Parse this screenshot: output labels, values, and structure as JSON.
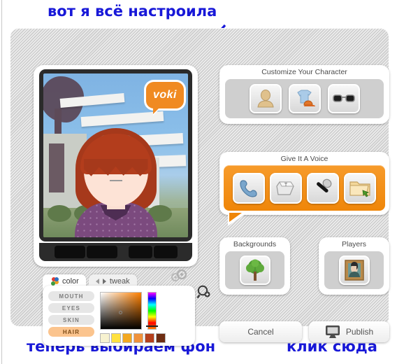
{
  "app": {
    "name": "voki-character-creator",
    "logo_text": "voki",
    "accent_color": "#f08a22",
    "panel_bg": "#dedede"
  },
  "preview": {
    "name": "avatar-preview",
    "dice_button_label": "",
    "zoom_button_label": "",
    "character": {
      "hair_color": "#a6391b",
      "skin_color": "#fde3d6",
      "outfit_color": "#7b4a7e",
      "has_glasses": true
    }
  },
  "color_panel": {
    "tabs": [
      {
        "label": "color",
        "active": true,
        "icon": "color-dots-icon"
      },
      {
        "label": "tweak",
        "active": false,
        "icon": "prev-next-arrows-icon"
      }
    ],
    "parts": [
      {
        "label": "MOUTH",
        "active": false
      },
      {
        "label": "EYES",
        "active": false
      },
      {
        "label": "SKIN",
        "active": false
      },
      {
        "label": "HAIR",
        "active": true
      }
    ],
    "swatches": [
      "#f7f2d0",
      "#ffe13f",
      "#f3a820",
      "#f0923b",
      "#b5401c",
      "#6e2d12"
    ],
    "selected_part": "HAIR",
    "picker_hue": "#ff8000"
  },
  "cards": {
    "customize": {
      "title": "Customize Your Character",
      "buttons": [
        {
          "icon": "head-silhouette-icon",
          "label": ""
        },
        {
          "icon": "clothing-shirt-cap-icon",
          "label": ""
        },
        {
          "icon": "sunglasses-icon",
          "label": ""
        }
      ]
    },
    "voice": {
      "title": "Give It A Voice",
      "highlight_color": "#ef8609",
      "buttons": [
        {
          "icon": "telephone-icon",
          "label": ""
        },
        {
          "icon": "keyboard-key-icon",
          "label": ""
        },
        {
          "icon": "microphone-icon",
          "label": ""
        },
        {
          "icon": "folder-upload-icon",
          "label": ""
        }
      ]
    },
    "backgrounds": {
      "title": "Backgrounds",
      "buttons": [
        {
          "icon": "tree-icon",
          "label": ""
        }
      ]
    },
    "players": {
      "title": "Players",
      "buttons": [
        {
          "icon": "framed-portrait-icon",
          "label": ""
        }
      ]
    }
  },
  "actions": {
    "cancel_label": "Cancel",
    "publish_label": "Publish",
    "publish_icon": "monitor-icon"
  },
  "annotations": {
    "color": "#1818d8",
    "top": "вот я всё настроила",
    "bottom_left": "теперь выбираем фон",
    "bottom_right": "клик сюда"
  }
}
